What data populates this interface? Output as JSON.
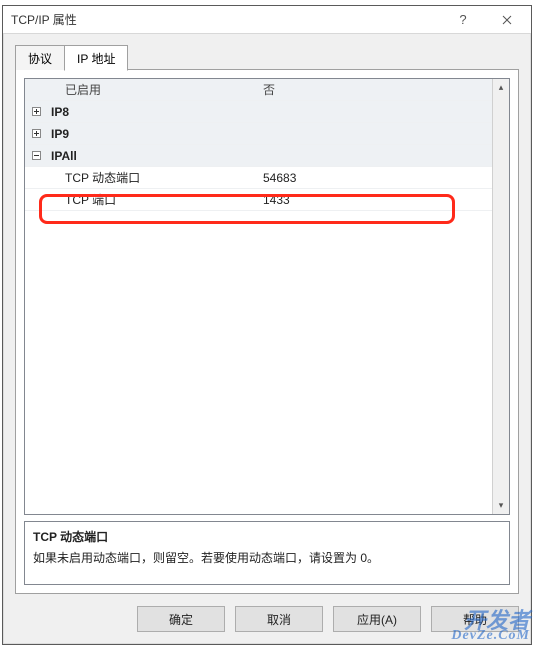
{
  "window": {
    "title": "TCP/IP 属性"
  },
  "tabs": {
    "protocol": "协议",
    "ip": "IP 地址"
  },
  "grid": {
    "header_enabled": "已启用",
    "header_value": "否",
    "ip8_label": "IP8",
    "ip9_label": "IP9",
    "ipall_label": "IPAll",
    "tcp_dynamic_ports_label": "TCP 动态端口",
    "tcp_dynamic_ports_value": "54683",
    "tcp_port_label": "TCP 端口",
    "tcp_port_value": "1433"
  },
  "description": {
    "title": "TCP 动态端口",
    "body": "如果未启用动态端口，则留空。若要使用动态端口，请设置为 0。"
  },
  "buttons": {
    "ok": "确定",
    "cancel": "取消",
    "apply": "应用(A)",
    "help": "帮助"
  },
  "watermark": {
    "line1": "开发者",
    "line2": "DevZe.CoM"
  }
}
